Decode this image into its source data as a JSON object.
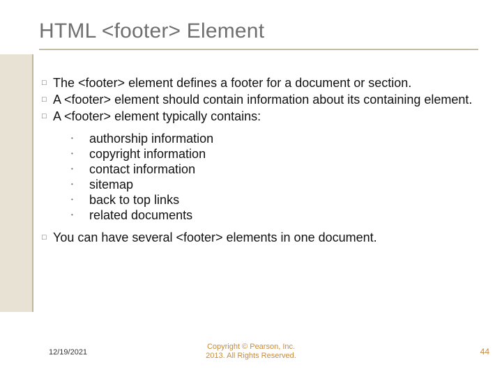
{
  "title": "HTML <footer> Element",
  "bullets": [
    "The <footer> element defines a footer for a document or section.",
    "A <footer> element should contain information about its containing element.",
    "A <footer> element typically contains:"
  ],
  "sub_bullets": [
    "authorship information",
    "copyright information",
    "contact information",
    "sitemap",
    "back to top links",
    "related documents"
  ],
  "bullets_after": [
    "You can have several <footer> elements in one document."
  ],
  "footer": {
    "date": "12/19/2021",
    "copyright_line1": "Copyright © Pearson, Inc.",
    "copyright_line2": "2013. All Rights Reserved.",
    "page_number": "44"
  },
  "markers": {
    "square": "□",
    "dot": "•"
  }
}
